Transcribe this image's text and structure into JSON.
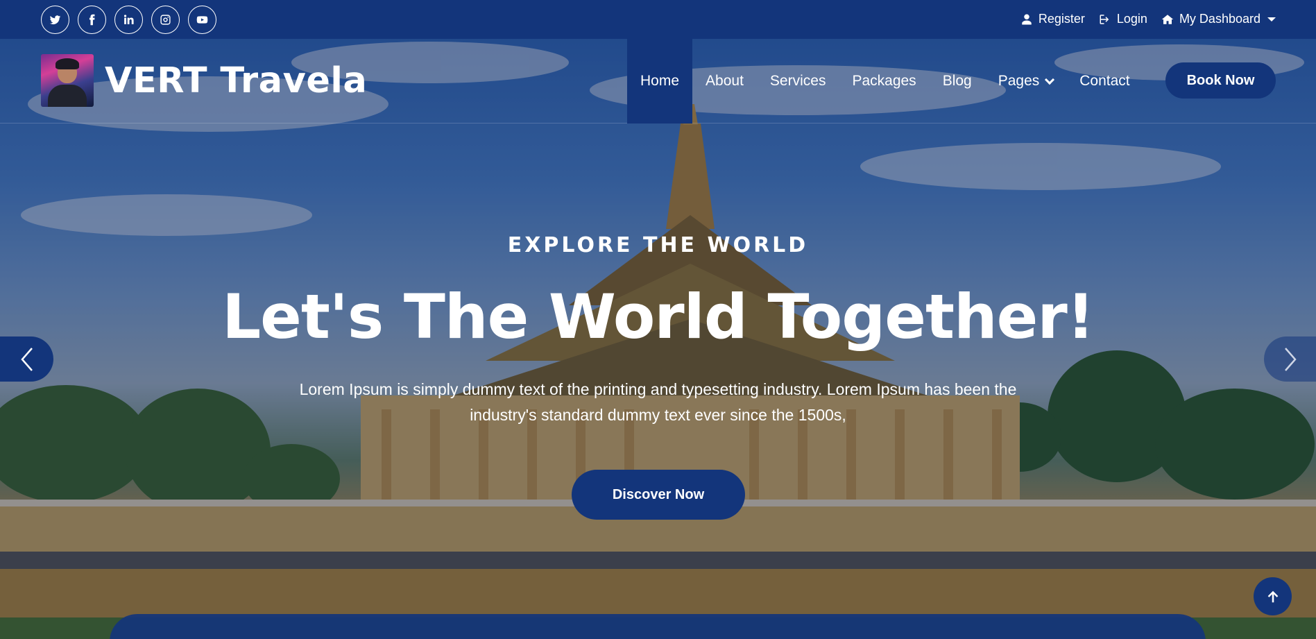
{
  "colors": {
    "brand": "#13357b",
    "text": "#ffffff"
  },
  "topbar": {
    "social_icons": [
      "twitter-icon",
      "facebook-icon",
      "linkedin-icon",
      "instagram-icon",
      "youtube-icon"
    ],
    "links": {
      "register": "Register",
      "login": "Login",
      "dashboard": "My Dashboard"
    }
  },
  "navbar": {
    "brand_name": "VERT Travela",
    "items": [
      {
        "label": "Home",
        "active": true
      },
      {
        "label": "About"
      },
      {
        "label": "Services"
      },
      {
        "label": "Packages"
      },
      {
        "label": "Blog"
      },
      {
        "label": "Pages",
        "has_dropdown": true
      },
      {
        "label": "Contact"
      }
    ],
    "cta": "Book Now"
  },
  "hero": {
    "eyebrow": "EXPLORE THE WORLD",
    "headline": "Let's The World Together!",
    "lead": "Lorem Ipsum is simply dummy text of the printing and typesetting industry. Lorem Ipsum has been the industry's standard dummy text ever since the 1500s,",
    "button": "Discover Now"
  }
}
